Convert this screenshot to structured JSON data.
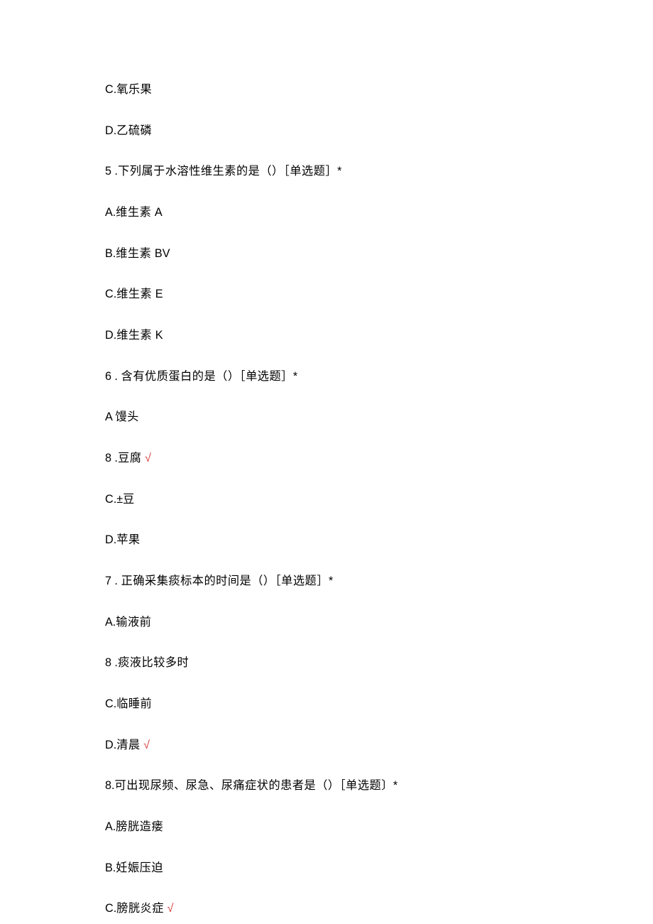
{
  "lines": [
    {
      "parts": [
        {
          "t": "C.",
          "latin": true
        },
        {
          "t": "氧乐果"
        }
      ]
    },
    {
      "parts": [
        {
          "t": "D.",
          "latin": true
        },
        {
          "t": "乙硫磷"
        }
      ]
    },
    {
      "parts": [
        {
          "t": "5",
          "latin": true
        },
        {
          "t": " ."
        },
        {
          "t": "下列属于水溶性维生素的是（）［单选题］"
        },
        {
          "t": "*",
          "latin": true
        }
      ]
    },
    {
      "parts": [
        {
          "t": "A.",
          "latin": true
        },
        {
          "t": "维生素 "
        },
        {
          "t": "A",
          "latin": true
        }
      ]
    },
    {
      "parts": [
        {
          "t": "B.",
          "latin": true
        },
        {
          "t": "维生素 "
        },
        {
          "t": "BV",
          "latin": true
        }
      ]
    },
    {
      "parts": [
        {
          "t": "C.",
          "latin": true
        },
        {
          "t": "维生素 "
        },
        {
          "t": "E",
          "latin": true
        }
      ]
    },
    {
      "parts": [
        {
          "t": "D.",
          "latin": true
        },
        {
          "t": "维生素 "
        },
        {
          "t": "K",
          "latin": true
        }
      ]
    },
    {
      "parts": [
        {
          "t": "6",
          "latin": true
        },
        {
          "t": " . "
        },
        {
          "t": "含有优质蛋白的是（）［单选题］"
        },
        {
          "t": "*",
          "latin": true
        }
      ]
    },
    {
      "parts": [
        {
          "t": "A ",
          "latin": true
        },
        {
          "t": "馒头"
        }
      ]
    },
    {
      "parts": [
        {
          "t": "8",
          "latin": true
        },
        {
          "t": " ."
        },
        {
          "t": "豆腐 "
        },
        {
          "t": "√",
          "correct": true
        }
      ]
    },
    {
      "parts": [
        {
          "t": "C.±",
          "latin": true
        },
        {
          "t": "豆"
        }
      ]
    },
    {
      "parts": [
        {
          "t": "D.",
          "latin": true
        },
        {
          "t": "苹果"
        }
      ]
    },
    {
      "parts": [
        {
          "t": "7",
          "latin": true
        },
        {
          "t": " . "
        },
        {
          "t": "正确采集痰标本的时间是（）［单选题］"
        },
        {
          "t": "*",
          "latin": true
        }
      ]
    },
    {
      "parts": [
        {
          "t": "A.",
          "latin": true
        },
        {
          "t": "输液前"
        }
      ]
    },
    {
      "parts": [
        {
          "t": "8",
          "latin": true
        },
        {
          "t": " ."
        },
        {
          "t": "痰液比较多时"
        }
      ]
    },
    {
      "parts": [
        {
          "t": "C.",
          "latin": true
        },
        {
          "t": "临睡前"
        }
      ]
    },
    {
      "parts": [
        {
          "t": "D.",
          "latin": true
        },
        {
          "t": "清晨 "
        },
        {
          "t": "√",
          "correct": true
        }
      ]
    },
    {
      "parts": [
        {
          "t": "8.",
          "latin": true
        },
        {
          "t": "可出现尿频、尿急、尿痛症状的患者是（）［单选题〕"
        },
        {
          "t": "*",
          "latin": true
        }
      ]
    },
    {
      "parts": [
        {
          "t": "A.",
          "latin": true
        },
        {
          "t": "膀胱造瘘"
        }
      ]
    },
    {
      "parts": [
        {
          "t": "B.",
          "latin": true
        },
        {
          "t": "妊娠压迫"
        }
      ]
    },
    {
      "parts": [
        {
          "t": "C.",
          "latin": true
        },
        {
          "t": "膀胱炎症 "
        },
        {
          "t": "√",
          "correct": true
        }
      ]
    }
  ]
}
